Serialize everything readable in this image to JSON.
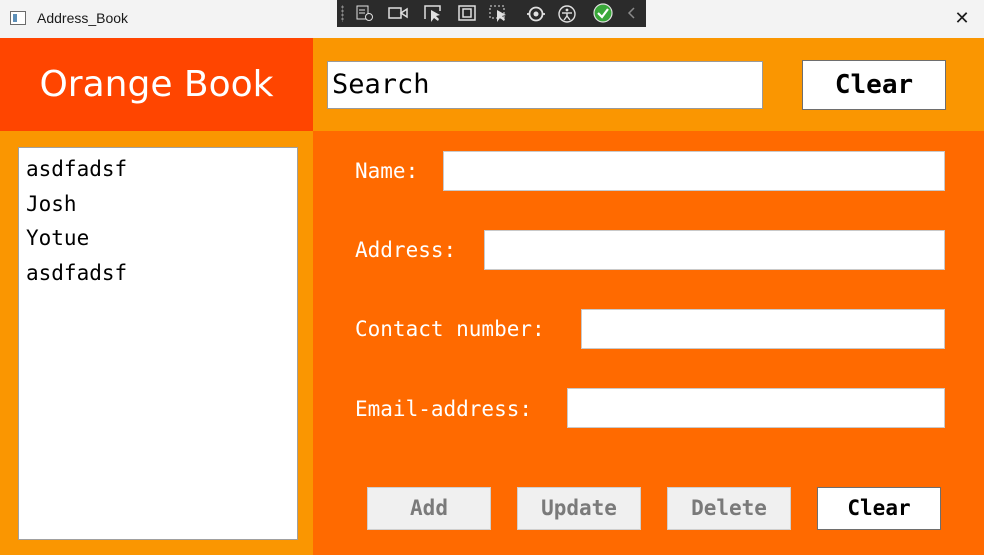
{
  "window": {
    "title": "Address_Book",
    "close_glyph": "✕"
  },
  "devtools": {
    "icons": [
      "select-element-icon",
      "record-icon",
      "pointer-select-icon",
      "layout-adorner-icon",
      "track-focus-icon",
      "hot-reload-icon",
      "accessibility-icon",
      "binding-check-icon",
      "collapse-chevron-icon"
    ]
  },
  "header": {
    "app_name": "Orange Book",
    "search_placeholder": "Search",
    "search_value": "",
    "clear_label": "Clear"
  },
  "contacts": [
    "asdfadsf",
    "Josh",
    "Yotue",
    "asdfadsf"
  ],
  "form": {
    "name_label": "Name:",
    "address_label": "Address:",
    "contact_label": "Contact number:",
    "email_label": "Email-address:",
    "name_value": "",
    "address_value": "",
    "contact_value": "",
    "email_value": ""
  },
  "actions": {
    "add": "Add",
    "update": "Update",
    "delete": "Delete",
    "clear": "Clear"
  },
  "colors": {
    "header_left": "#ff4500",
    "accent": "#fa9601",
    "form_bg": "#ff6a00"
  }
}
